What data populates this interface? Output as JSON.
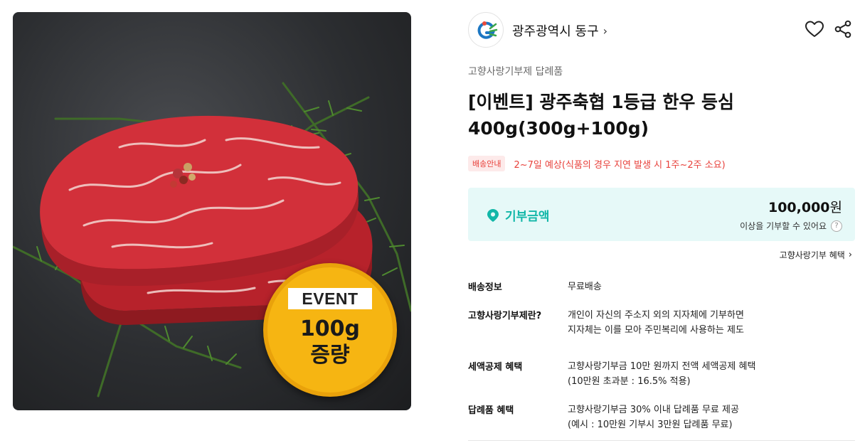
{
  "image": {
    "badge_label": "EVENT",
    "badge_amount": "100g",
    "badge_sub": "증량"
  },
  "seller": {
    "name": "광주광역시 동구",
    "chevron": "›"
  },
  "category": "고향사랑기부제 답례품",
  "title_line1": "[이벤트] 광주축협 1등급 한우 등심",
  "title_line2": "400g(300g+100g)",
  "delivery": {
    "tag": "배송안내",
    "text": "2~7일 예상(식품의 경우 지연 발생 시 1주~2주 소요)"
  },
  "donation": {
    "label": "기부금액",
    "amount": "100,000",
    "unit": "원",
    "note": "이상을 기부할 수 있어요",
    "help": "?"
  },
  "benefit_link": "고향사랑기부 혜택",
  "info": [
    {
      "key": "배송정보",
      "line1": "무료배송",
      "line2": ""
    },
    {
      "key": "고향사랑기부제란?",
      "line1": "개인이 자신의 주소지 외의 지자체에 기부하면",
      "line2": "지자체는 이를 모아 주민복리에 사용하는 제도"
    },
    {
      "key": "세액공제 혜택",
      "line1": "고향사랑기부금 10만 원까지 전액 세액공제 혜택",
      "line2": "(10만원 초과분 : 16.5% 적용)"
    },
    {
      "key": "답례품 혜택",
      "line1": "고향사랑기부금 30% 이내 답례품 무료 제공",
      "line2": "(예시 : 10만원 기부시 3만원 답례품 무료)"
    }
  ],
  "icons": {
    "heart": "heart-icon",
    "share": "share-icon",
    "location": "map-pin-icon",
    "help": "help-icon",
    "chevron": "chevron-right-icon"
  },
  "colors": {
    "accent": "#12b7a8",
    "alert": "#e8413b",
    "donation_bg": "#e6f9f8",
    "badge": "#f6b512"
  }
}
